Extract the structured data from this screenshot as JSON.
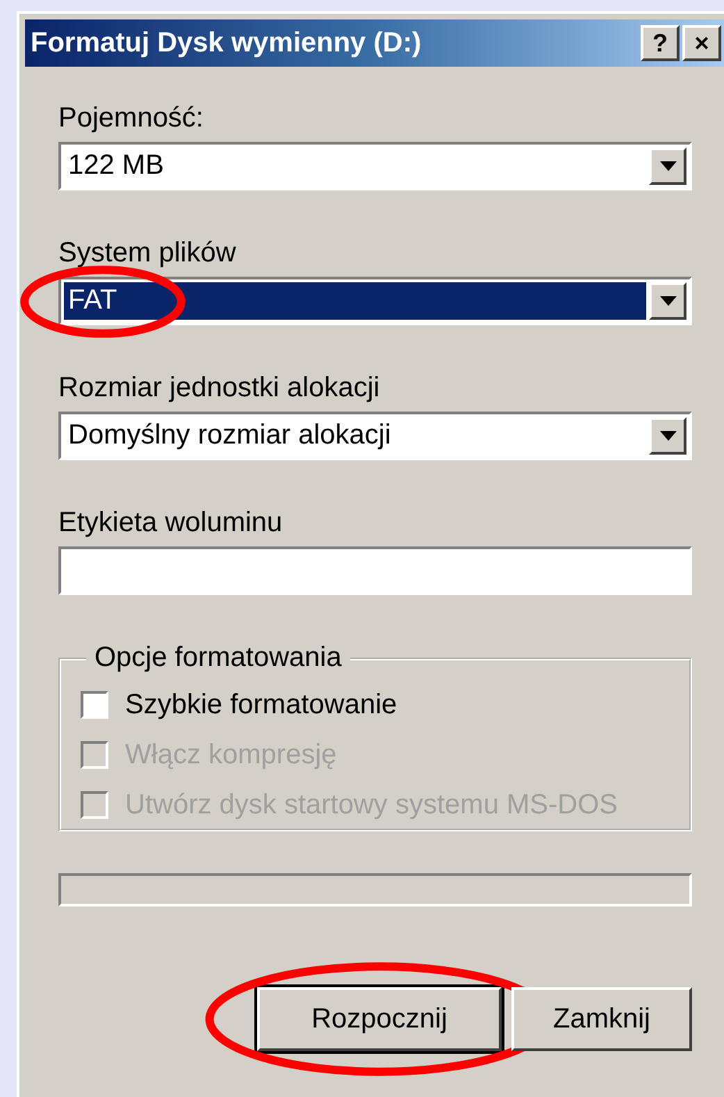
{
  "window": {
    "title": "Formatuj Dysk wymienny (D:)",
    "title_buttons": [
      "?",
      "×"
    ]
  },
  "fields": [
    {
      "kind": "combo",
      "label": "Pojemność:",
      "value": "122 MB",
      "selected": false,
      "circled": false
    },
    {
      "kind": "combo",
      "label": "System plików",
      "value": "FAT",
      "selected": true,
      "circled": true
    },
    {
      "kind": "combo",
      "label": "Rozmiar jednostki alokacji",
      "value": "Domyślny rozmiar alokacji",
      "selected": false,
      "circled": false
    },
    {
      "kind": "text",
      "label": "Etykieta woluminu",
      "circled": false
    }
  ],
  "options": {
    "title": "Opcje formatowania",
    "items": [
      {
        "label": "Szybkie formatowanie",
        "checked": false,
        "disabled": false
      },
      {
        "label": "Włącz kompresję",
        "checked": false,
        "disabled": true
      },
      {
        "label": "Utwórz dysk startowy systemu MS-DOS",
        "checked": false,
        "disabled": true
      }
    ]
  },
  "progress": {
    "level": 0
  },
  "buttons": [
    {
      "label": "Rozpocznij",
      "default": true,
      "circled": true
    },
    {
      "label": "Zamknij",
      "default": false,
      "circled": false
    }
  ]
}
